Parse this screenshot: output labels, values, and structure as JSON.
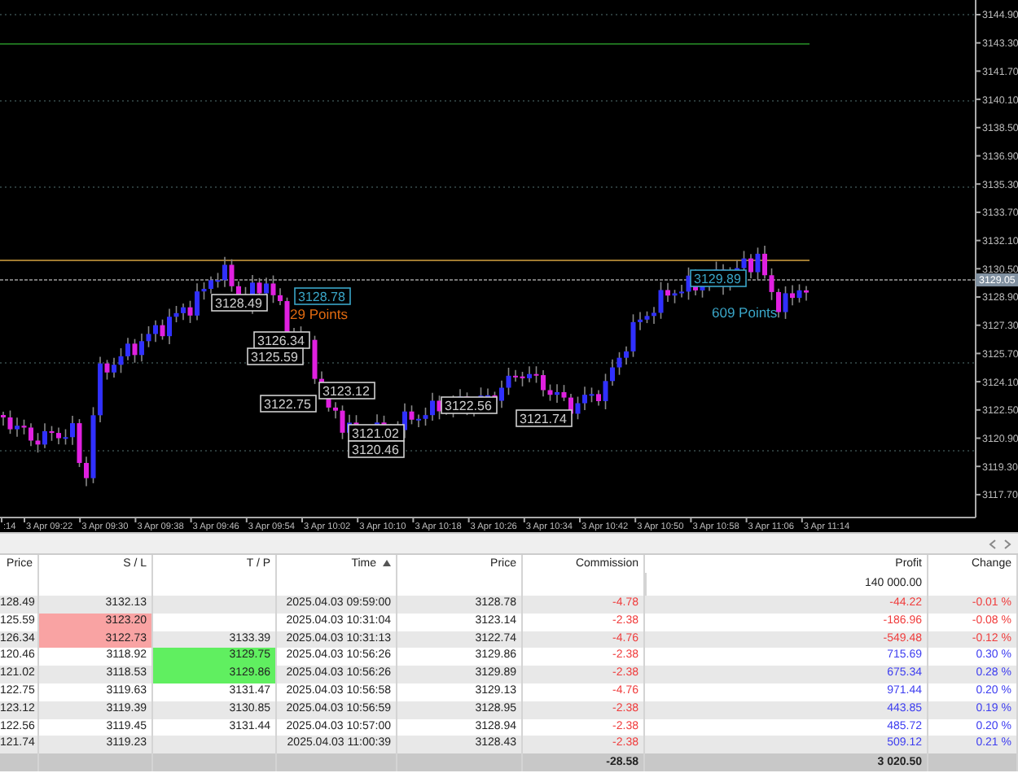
{
  "chart": {
    "price_axis": [
      "3144.90",
      "3143.30",
      "3141.70",
      "3140.10",
      "3138.50",
      "3136.90",
      "3135.30",
      "3133.70",
      "3132.10",
      "3130.50",
      "3128.90",
      "3127.30",
      "3125.70",
      "3124.10",
      "3122.50",
      "3120.90",
      "3119.30",
      "3117.70"
    ],
    "current_price": "3129.05",
    "time_axis": [
      ":14",
      "3 Apr 09:22",
      "3 Apr 09:30",
      "3 Apr 09:38",
      "3 Apr 09:46",
      "3 Apr 09:54",
      "3 Apr 10:02",
      "3 Apr 10:10",
      "3 Apr 10:18",
      "3 Apr 10:26",
      "3 Apr 10:34",
      "3 Apr 10:42",
      "3 Apr 10:50",
      "3 Apr 10:58",
      "3 Apr 11:06",
      "3 Apr 11:14"
    ],
    "trade_labels": [
      {
        "text": "3128.49",
        "kind": "box",
        "color": "#d0d0d0"
      },
      {
        "text": "3128.78",
        "kind": "box",
        "color": "#3aa6c8"
      },
      {
        "text": "29 Points",
        "kind": "text",
        "color": "#e06a10"
      },
      {
        "text": "3126.34",
        "kind": "box",
        "color": "#d0d0d0"
      },
      {
        "text": "3125.59",
        "kind": "box",
        "color": "#d0d0d0"
      },
      {
        "text": "3122.75",
        "kind": "box",
        "color": "#d0d0d0"
      },
      {
        "text": "3123.12",
        "kind": "box",
        "color": "#d0d0d0"
      },
      {
        "text": "3121.02",
        "kind": "box",
        "color": "#d0d0d0"
      },
      {
        "text": "3120.46",
        "kind": "box",
        "color": "#d0d0d0"
      },
      {
        "text": "3122.56",
        "kind": "box",
        "color": "#d0d0d0"
      },
      {
        "text": "3121.74",
        "kind": "box",
        "color": "#d0d0d0"
      },
      {
        "text": "3129.89",
        "kind": "box",
        "color": "#3aa6c8"
      },
      {
        "text": "609 Points",
        "kind": "text",
        "color": "#3aa6c8"
      }
    ]
  },
  "table": {
    "columns": [
      {
        "label": "Price",
        "sorted": false
      },
      {
        "label": "S / L",
        "sorted": false
      },
      {
        "label": "T / P",
        "sorted": false
      },
      {
        "label": "Time",
        "sorted": true
      },
      {
        "label": "Price",
        "sorted": false
      },
      {
        "label": "Commission",
        "sorted": false
      },
      {
        "label": "Profit",
        "sorted": false
      },
      {
        "label": "Change",
        "sorted": false
      }
    ],
    "balance": "140 000.00",
    "rows": [
      {
        "open_price": "128.49",
        "sl": "3132.13",
        "time": "2025.04.03 09:59:00",
        "price": "3128.78",
        "commission": "-4.78",
        "profit": "-44.22",
        "change": "-0.01 %",
        "sl_hit": false,
        "tp_hit": false,
        "profit_positive": false
      },
      {
        "open_price": "125.59",
        "sl": "3123.20",
        "time": "2025.04.03 10:31:04",
        "price": "3123.14",
        "commission": "-2.38",
        "profit": "-186.96",
        "change": "-0.08 %",
        "sl_hit": true,
        "tp_hit": false,
        "profit_positive": false
      },
      {
        "open_price": "126.34",
        "sl": "3122.73",
        "tp": "3133.39",
        "time": "2025.04.03 10:31:13",
        "price": "3122.74",
        "commission": "-4.76",
        "profit": "-549.48",
        "change": "-0.12 %",
        "sl_hit": true,
        "tp_hit": false,
        "profit_positive": false
      },
      {
        "open_price": "120.46",
        "sl": "3118.92",
        "tp": "3129.75",
        "time": "2025.04.03 10:56:26",
        "price": "3129.86",
        "commission": "-2.38",
        "profit": "715.69",
        "change": "0.30 %",
        "sl_hit": false,
        "tp_hit": true,
        "profit_positive": true
      },
      {
        "open_price": "121.02",
        "sl": "3118.53",
        "tp": "3129.86",
        "time": "2025.04.03 10:56:26",
        "price": "3129.89",
        "commission": "-2.38",
        "profit": "675.34",
        "change": "0.28 %",
        "sl_hit": false,
        "tp_hit": true,
        "profit_positive": true
      },
      {
        "open_price": "122.75",
        "sl": "3119.63",
        "tp": "3131.47",
        "time": "2025.04.03 10:56:58",
        "price": "3129.13",
        "commission": "-4.76",
        "profit": "971.44",
        "change": "0.20 %",
        "sl_hit": false,
        "tp_hit": false,
        "profit_positive": true
      },
      {
        "open_price": "123.12",
        "sl": "3119.39",
        "tp": "3130.85",
        "time": "2025.04.03 10:56:59",
        "price": "3128.95",
        "commission": "-2.38",
        "profit": "443.85",
        "change": "0.19 %",
        "sl_hit": false,
        "tp_hit": false,
        "profit_positive": true
      },
      {
        "open_price": "122.56",
        "sl": "3119.45",
        "tp": "3131.44",
        "time": "2025.04.03 10:57:00",
        "price": "3128.94",
        "commission": "-2.38",
        "profit": "485.72",
        "change": "0.20 %",
        "sl_hit": false,
        "tp_hit": false,
        "profit_positive": true
      },
      {
        "open_price": "121.74",
        "sl": "3119.23",
        "time": "2025.04.03 11:00:39",
        "price": "3128.43",
        "commission": "-2.38",
        "profit": "509.12",
        "change": "0.21 %",
        "sl_hit": false,
        "tp_hit": false,
        "profit_positive": true
      }
    ],
    "totals": {
      "commission": "-28.58",
      "profit": "3 020.50"
    }
  }
}
